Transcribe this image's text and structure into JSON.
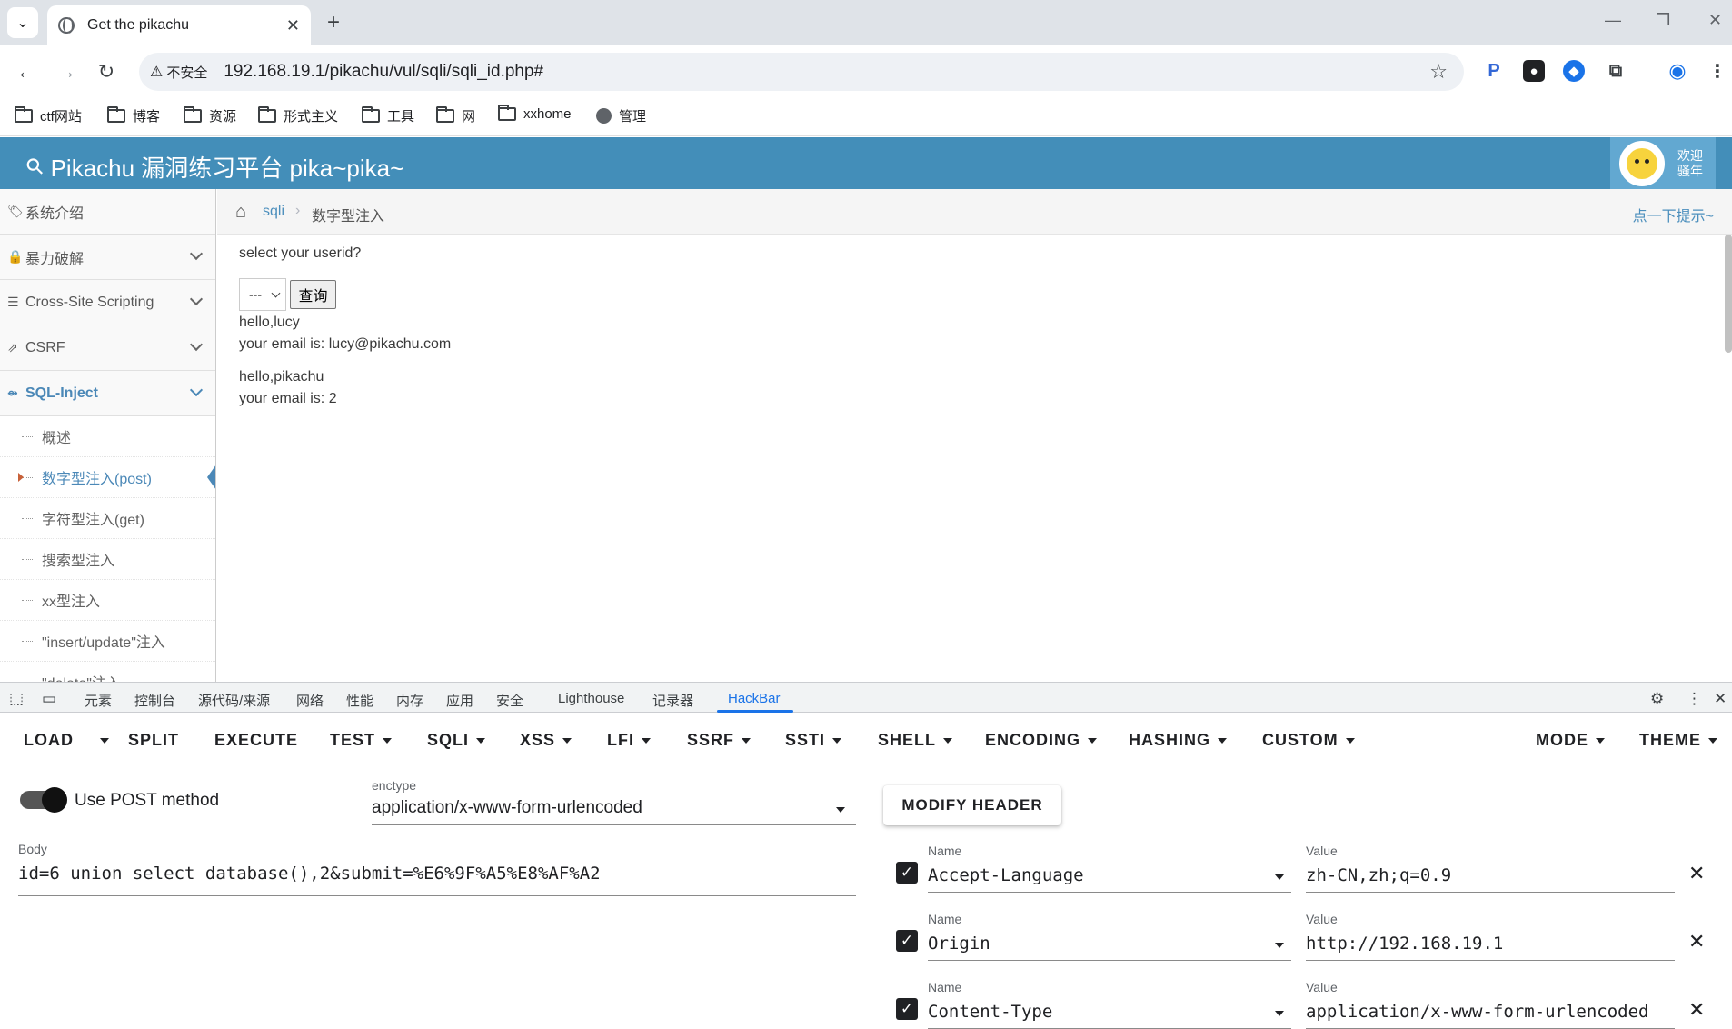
{
  "browser": {
    "tab_title": "Get the pikachu",
    "insecure_label": "不安全",
    "url": "192.168.19.1/pikachu/vul/sqli/sqli_id.php#"
  },
  "bookmarks": [
    {
      "label": "ctf网站",
      "icon": "folder-icon"
    },
    {
      "label": "博客",
      "icon": "folder-icon"
    },
    {
      "label": "资源",
      "icon": "folder-icon"
    },
    {
      "label": "形式主义",
      "icon": "folder-icon"
    },
    {
      "label": "工具",
      "icon": "folder-icon"
    },
    {
      "label": "网",
      "icon": "folder-icon"
    },
    {
      "label": "xxhome",
      "icon": "folder-icon"
    },
    {
      "label": "管理",
      "icon": "globe-icon"
    }
  ],
  "header": {
    "title": "Pikachu 漏洞练习平台 pika~pika~",
    "welcome_line1": "欢迎",
    "welcome_line2": "骚年"
  },
  "sidebar": {
    "items": [
      {
        "label": "系统介绍"
      },
      {
        "label": "暴力破解"
      },
      {
        "label": "Cross-Site Scripting"
      },
      {
        "label": "CSRF"
      },
      {
        "label": "SQL-Inject"
      }
    ],
    "subitems": [
      {
        "label": "概述"
      },
      {
        "label": "数字型注入(post)"
      },
      {
        "label": "字符型注入(get)"
      },
      {
        "label": "搜索型注入"
      },
      {
        "label": "xx型注入"
      },
      {
        "label": "\"insert/update\"注入"
      },
      {
        "label": "\"delete\"注入"
      }
    ]
  },
  "breadcrumb": {
    "section": "sqli",
    "current": "数字型注入",
    "hint": "点一下提示~"
  },
  "main": {
    "prompt": "select your userid?",
    "select_value": "---",
    "query_button": "查询",
    "results": [
      {
        "hello": "hello,lucy",
        "email": "your email is: lucy@pikachu.com"
      },
      {
        "hello": "hello,pikachu",
        "email": "your email is: 2"
      }
    ]
  },
  "devtools": {
    "tabs": [
      "元素",
      "控制台",
      "源代码/来源",
      "网络",
      "性能",
      "内存",
      "应用",
      "安全",
      "Lighthouse",
      "记录器",
      "HackBar"
    ],
    "active_tab": "HackBar"
  },
  "hackbar": {
    "menu": [
      "LOAD",
      "SPLIT",
      "EXECUTE",
      "TEST",
      "SQLI",
      "XSS",
      "LFI",
      "SSRF",
      "SSTI",
      "SHELL",
      "ENCODING",
      "HASHING",
      "CUSTOM",
      "MODE",
      "THEME"
    ],
    "use_post_label": "Use POST method",
    "use_post_enabled": true,
    "enctype_label": "enctype",
    "enctype_value": "application/x-www-form-urlencoded",
    "modify_header_label": "MODIFY HEADER",
    "body_label": "Body",
    "body_value": "id=6 union select database(),2&submit=%E6%9F%A5%E8%AF%A2",
    "name_label": "Name",
    "value_label": "Value",
    "headers": [
      {
        "checked": true,
        "name": "Accept-Language",
        "value": "zh-CN,zh;q=0.9"
      },
      {
        "checked": true,
        "name": "Origin",
        "value": "http://192.168.19.1"
      },
      {
        "checked": true,
        "name": "Content-Type",
        "value": "application/x-www-form-urlencoded"
      }
    ]
  },
  "colors": {
    "header_blue": "#438eb9",
    "active_link": "#4b88b7",
    "devtools_accent": "#1a73e8"
  }
}
